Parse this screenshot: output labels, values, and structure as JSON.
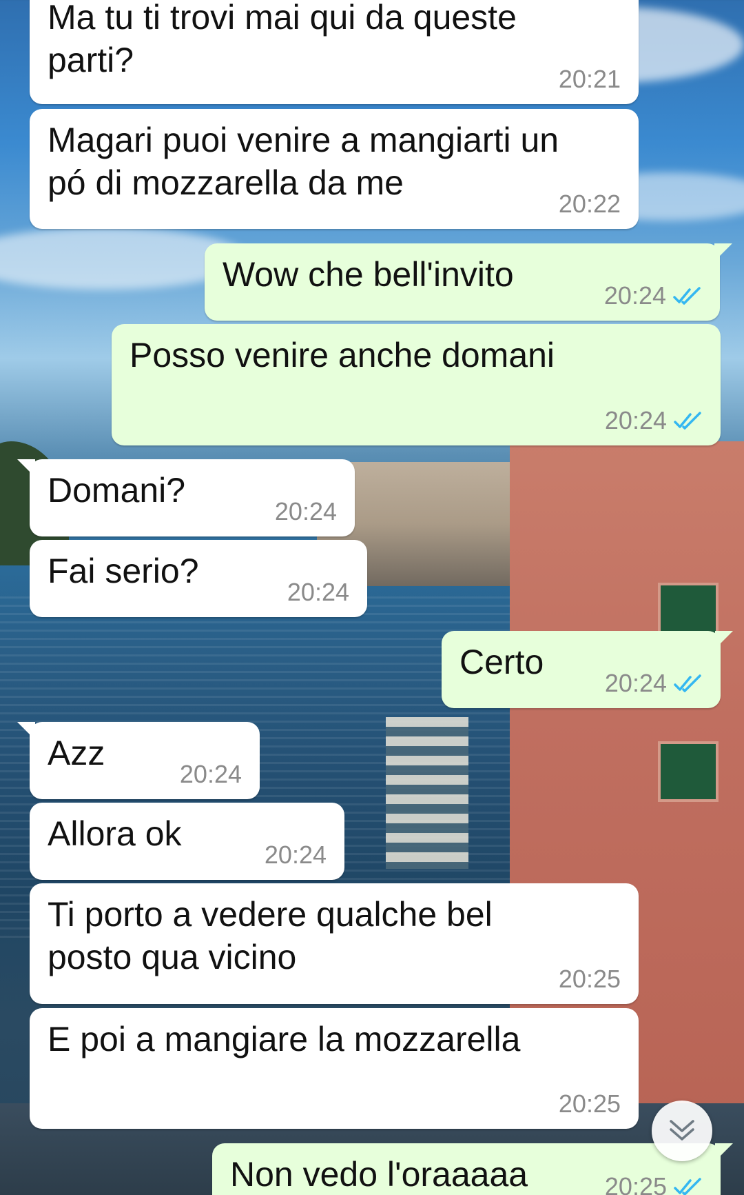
{
  "messages": [
    {
      "dir": "in",
      "text": "Ma tu ti trovi mai qui da queste\nparti?",
      "time": "20:21"
    },
    {
      "dir": "in",
      "text": "Magari puoi venire a mangiarti un\npó di mozzarella da me",
      "time": "20:22"
    },
    {
      "dir": "out",
      "text": "Wow che bell'invito",
      "time": "20:24",
      "status": "read"
    },
    {
      "dir": "out",
      "text": "Posso venire anche domani",
      "time": "20:24",
      "status": "read"
    },
    {
      "dir": "in",
      "text": "Domani?",
      "time": "20:24"
    },
    {
      "dir": "in",
      "text": "Fai serio?",
      "time": "20:24"
    },
    {
      "dir": "out",
      "text": "Certo",
      "time": "20:24",
      "status": "read"
    },
    {
      "dir": "in",
      "text": "Azz",
      "time": "20:24"
    },
    {
      "dir": "in",
      "text": "Allora ok",
      "time": "20:24"
    },
    {
      "dir": "in",
      "text": "Ti porto a vedere qualche bel\nposto qua vicino",
      "time": "20:25"
    },
    {
      "dir": "in",
      "text": "E poi a mangiare la mozzarella",
      "time": "20:25"
    },
    {
      "dir": "out",
      "text": "Non vedo l'oraaaaa",
      "time": "20:25",
      "status": "read"
    }
  ],
  "icons": {
    "read_tick": "double-check-icon",
    "scroll_down": "double-chevron-down-icon"
  },
  "colors": {
    "incoming_bubble": "#ffffff",
    "outgoing_bubble": "#e7ffdb",
    "timestamp": "#8a8a8a",
    "read_tick": "#34b7f1"
  }
}
